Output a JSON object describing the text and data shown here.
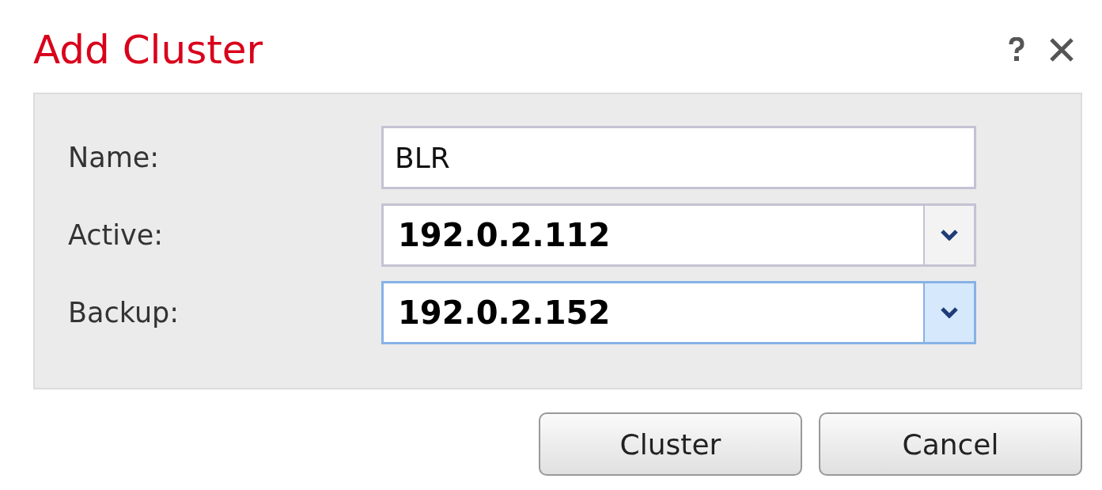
{
  "dialog": {
    "title": "Add Cluster"
  },
  "fields": [
    {
      "label": "Name:",
      "kind": "text",
      "value": "BLR",
      "focused": false
    },
    {
      "label": "Active:",
      "kind": "select",
      "value": "192.0.2.112",
      "focused": false
    },
    {
      "label": "Backup:",
      "kind": "select",
      "value": "192.0.2.152",
      "focused": true
    }
  ],
  "buttons": [
    "Cluster",
    "Cancel"
  ]
}
